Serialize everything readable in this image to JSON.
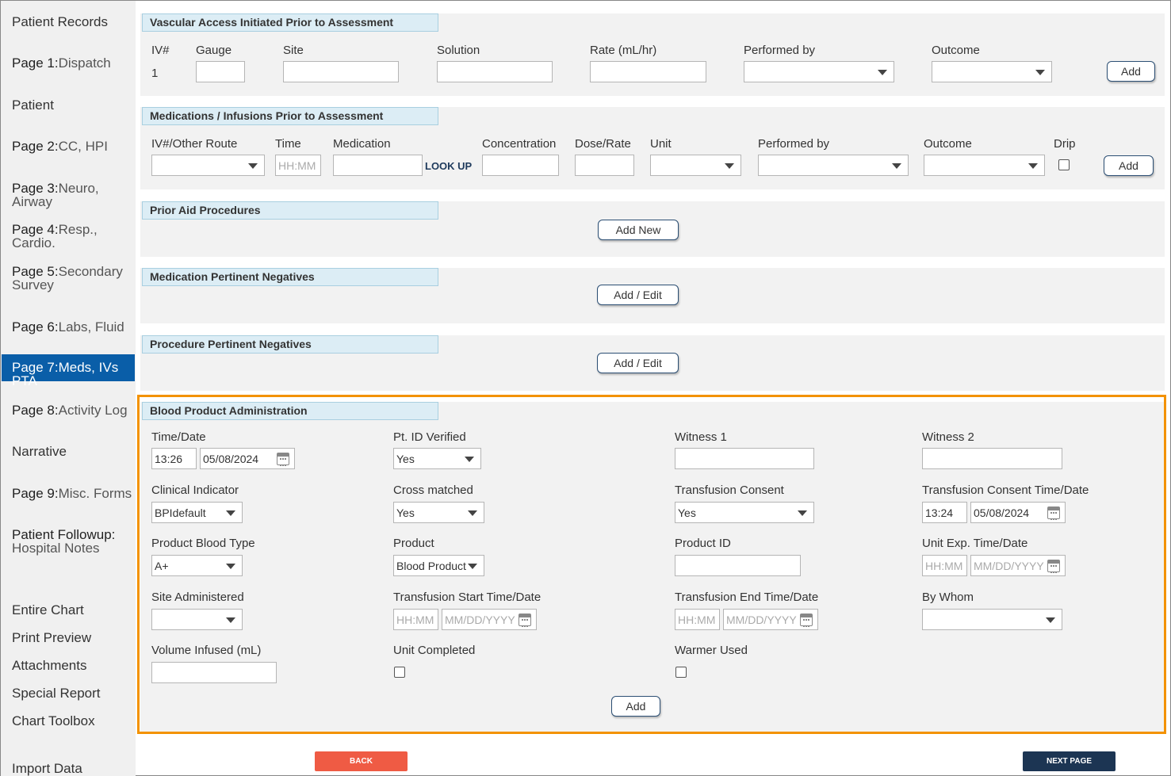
{
  "sidebar": {
    "items": [
      {
        "num": "",
        "label": "Patient Records"
      },
      {
        "num": "Page 1:",
        "label": "Dispatch"
      },
      {
        "num": "",
        "label": "Patient"
      },
      {
        "num": "Page 2:",
        "label": "CC, HPI"
      },
      {
        "num": "Page 3:",
        "label": "Neuro, Airway"
      },
      {
        "num": "Page 4:",
        "label": "Resp., Cardio."
      },
      {
        "num": "Page 5:",
        "label": "Secondary",
        "label2": "Survey"
      },
      {
        "num": "Page 6:",
        "label": "Labs, Fluid"
      },
      {
        "num": "Page 7:",
        "label": "Meds, IVs PTA"
      },
      {
        "num": "Page 8:",
        "label": "Activity Log"
      },
      {
        "num": "",
        "label": "Narrative"
      },
      {
        "num": "Page 9:",
        "label": "Misc. Forms"
      },
      {
        "num": "Patient Followup:",
        "label": "Hospital Notes"
      },
      {
        "num": "",
        "label": "Entire Chart"
      },
      {
        "num": "",
        "label": "Print Preview"
      },
      {
        "num": "",
        "label": "Attachments"
      },
      {
        "num": "",
        "label": "Special Report"
      },
      {
        "num": "",
        "label": "Chart Toolbox"
      },
      {
        "num": "",
        "label": "Import Data"
      }
    ]
  },
  "vascular": {
    "title": "Vascular Access Initiated Prior to Assessment",
    "labels": {
      "iv": "IV#",
      "gauge": "Gauge",
      "site": "Site",
      "solution": "Solution",
      "rate": "Rate (mL/hr)",
      "performed_by": "Performed by",
      "outcome": "Outcome"
    },
    "iv_value": "1",
    "add": "Add"
  },
  "medications": {
    "title": "Medications / Infusions Prior to Assessment",
    "labels": {
      "route": "IV#/Other Route",
      "time": "Time",
      "medication": "Medication",
      "concentration": "Concentration",
      "dose_rate": "Dose/Rate",
      "unit": "Unit",
      "performed_by": "Performed by",
      "outcome": "Outcome",
      "drip": "Drip"
    },
    "time_placeholder": "HH:MM",
    "lookup": "LOOK UP",
    "add": "Add"
  },
  "prior_aid": {
    "title": "Prior Aid Procedures",
    "button": "Add New"
  },
  "med_negatives": {
    "title": "Medication Pertinent Negatives",
    "button": "Add / Edit"
  },
  "proc_negatives": {
    "title": "Procedure Pertinent Negatives",
    "button": "Add / Edit"
  },
  "blood": {
    "title": "Blood Product Administration",
    "time_date": {
      "label": "Time/Date",
      "time": "13:26",
      "date": "05/08/2024"
    },
    "pt_id_verified": {
      "label": "Pt. ID Verified",
      "value": "Yes"
    },
    "witness1": {
      "label": "Witness 1"
    },
    "witness2": {
      "label": "Witness 2"
    },
    "clinical_indicator": {
      "label": "Clinical Indicator",
      "value": "BPIdefault"
    },
    "cross_matched": {
      "label": "Cross matched",
      "value": "Yes"
    },
    "transfusion_consent": {
      "label": "Transfusion Consent",
      "value": "Yes"
    },
    "consent_time_date": {
      "label": "Transfusion Consent Time/Date",
      "time": "13:24",
      "date": "05/08/2024"
    },
    "blood_type": {
      "label": "Product Blood Type",
      "value": "A+"
    },
    "product": {
      "label": "Product",
      "value": "Blood Product"
    },
    "product_id": {
      "label": "Product ID"
    },
    "unit_exp": {
      "label": "Unit Exp. Time/Date",
      "time_ph": "HH:MM",
      "date_ph": "MM/DD/YYYY"
    },
    "site_administered": {
      "label": "Site Administered"
    },
    "start_time": {
      "label": "Transfusion Start Time/Date",
      "time_ph": "HH:MM",
      "date_ph": "MM/DD/YYYY"
    },
    "end_time": {
      "label": "Transfusion End Time/Date",
      "time_ph": "HH:MM",
      "date_ph": "MM/DD/YYYY"
    },
    "by_whom": {
      "label": "By Whom"
    },
    "volume": {
      "label": "Volume Infused (mL)"
    },
    "unit_completed": {
      "label": "Unit Completed"
    },
    "warmer_used": {
      "label": "Warmer Used"
    },
    "add": "Add"
  },
  "footer": {
    "back": "BACK",
    "next": "NEXT PAGE"
  },
  "colors": {
    "active": "#0a5ea8",
    "highlight": "#f39200",
    "back": "#ef5b44",
    "next": "#1c3553",
    "section_head": "#dcedf5"
  }
}
